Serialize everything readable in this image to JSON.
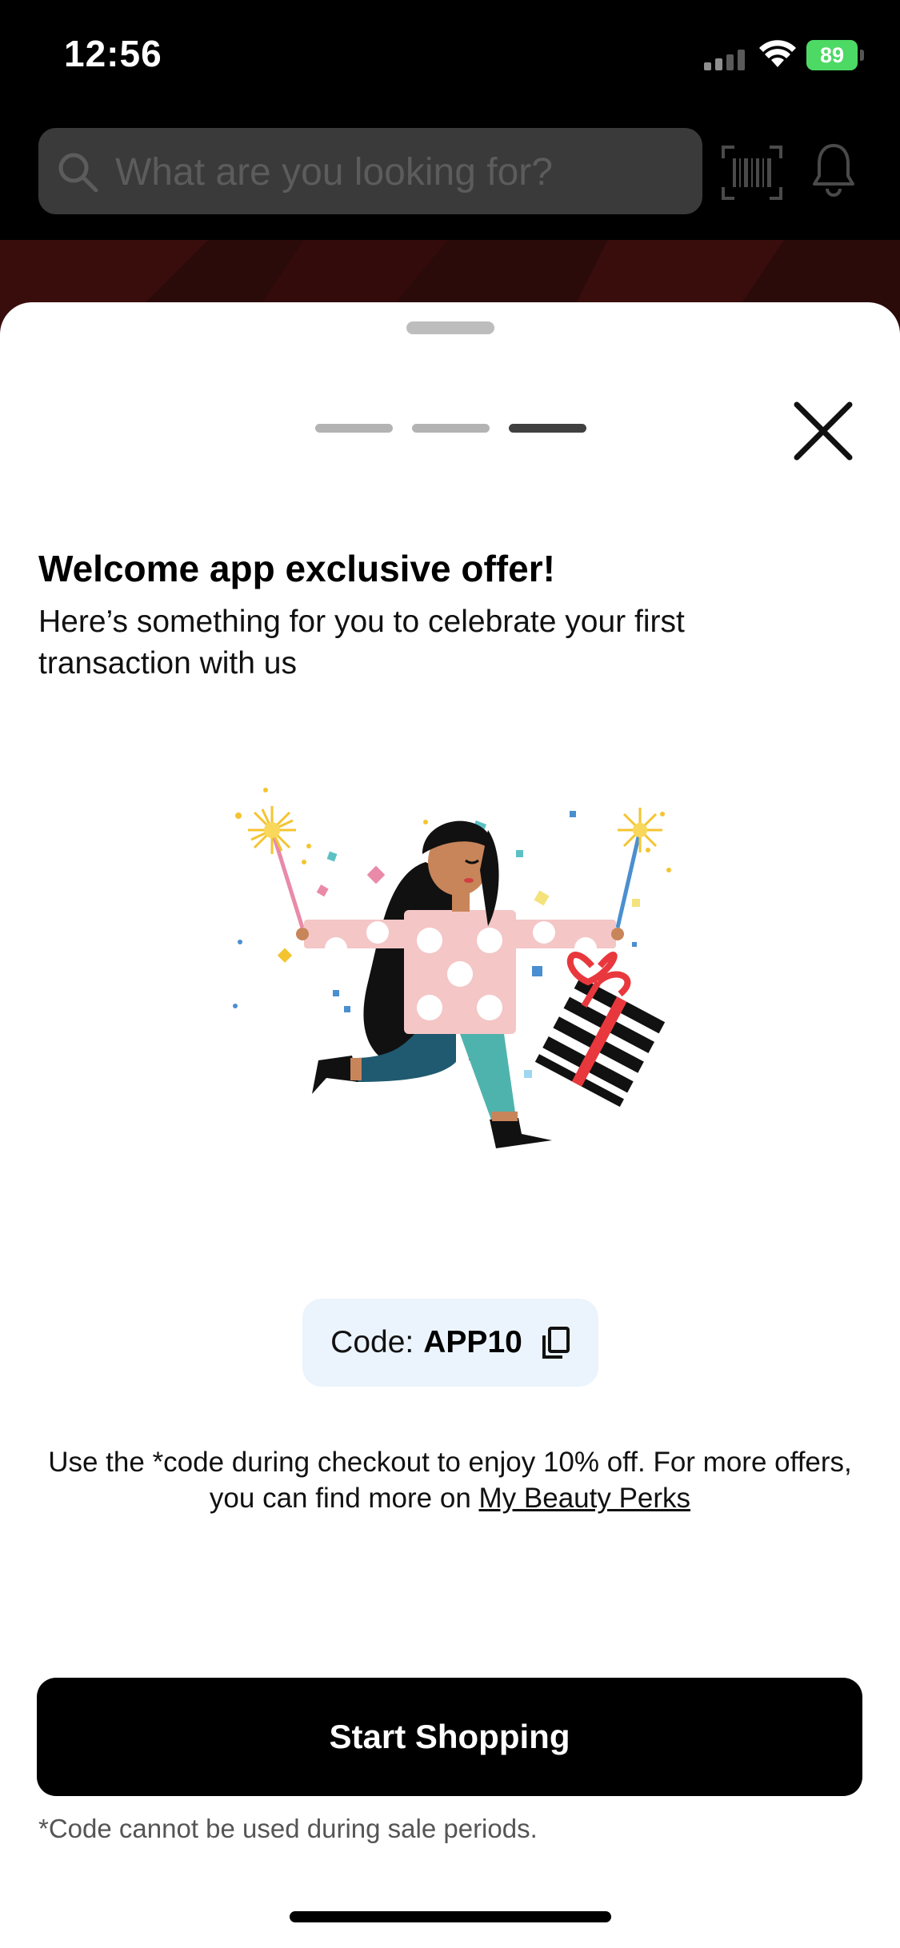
{
  "status_bar": {
    "time": "12:56",
    "battery_level": "89",
    "icons": [
      "signal-icon",
      "wifi-icon",
      "battery-icon"
    ]
  },
  "header": {
    "search_placeholder": "What are you looking for?",
    "icons": [
      "search-icon",
      "barcode-scan-icon",
      "bell-icon"
    ]
  },
  "sheet": {
    "pager": {
      "total": 3,
      "active_index": 2
    },
    "title": "Welcome app exclusive offer!",
    "subtitle": "Here’s something for you to celebrate your first transaction with us",
    "code_label": "Code:",
    "code_value": "APP10",
    "description_text": "Use the *code during checkout to enjoy 10% off. For more offers, you can find more on ",
    "perks_link": "My Beauty Perks",
    "primary_button": "Start Shopping",
    "disclaimer": "*Code cannot be used during sale periods."
  },
  "colors": {
    "sheet_background": "#ffffff",
    "code_chip_background": "#ebf4fc",
    "button_background": "#000000",
    "battery_green": "#4cd964"
  }
}
